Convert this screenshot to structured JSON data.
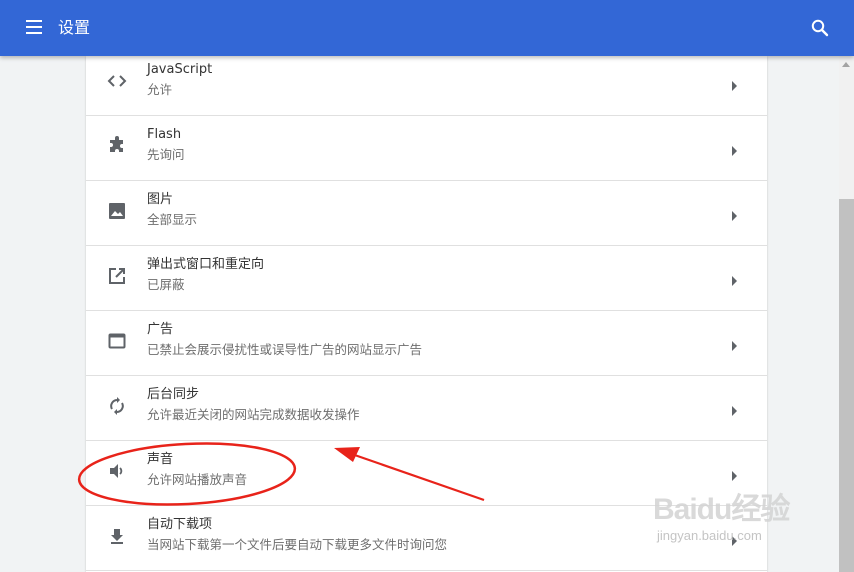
{
  "header": {
    "title": "设置",
    "menu_icon": "menu-icon",
    "search_icon": "search-icon",
    "color": "#3367d6"
  },
  "settings": {
    "rows": [
      {
        "title": "JavaScript",
        "subtitle": "允许",
        "icon": "code-icon"
      },
      {
        "title": "Flash",
        "subtitle": "先询问",
        "icon": "puzzle-icon"
      },
      {
        "title": "图片",
        "subtitle": "全部显示",
        "icon": "image-icon"
      },
      {
        "title": "弹出式窗口和重定向",
        "subtitle": "已屏蔽",
        "icon": "open-in-new-icon"
      },
      {
        "title": "广告",
        "subtitle": "已禁止会展示侵扰性或误导性广告的网站显示广告",
        "icon": "web-window-icon"
      },
      {
        "title": "后台同步",
        "subtitle": "允许最近关闭的网站完成数据收发操作",
        "icon": "sync-icon"
      },
      {
        "title": "声音",
        "subtitle": "允许网站播放声音",
        "icon": "volume-icon"
      },
      {
        "title": "自动下载项",
        "subtitle": "当网站下载第一个文件后要自动下载更多文件时询问您",
        "icon": "download-icon"
      }
    ]
  },
  "annotation": {
    "highlight_color": "#e8231a",
    "highlighted_row": "声音"
  },
  "watermark": {
    "text": "Baidu经验",
    "sub": "jingyan.baidu.com"
  }
}
